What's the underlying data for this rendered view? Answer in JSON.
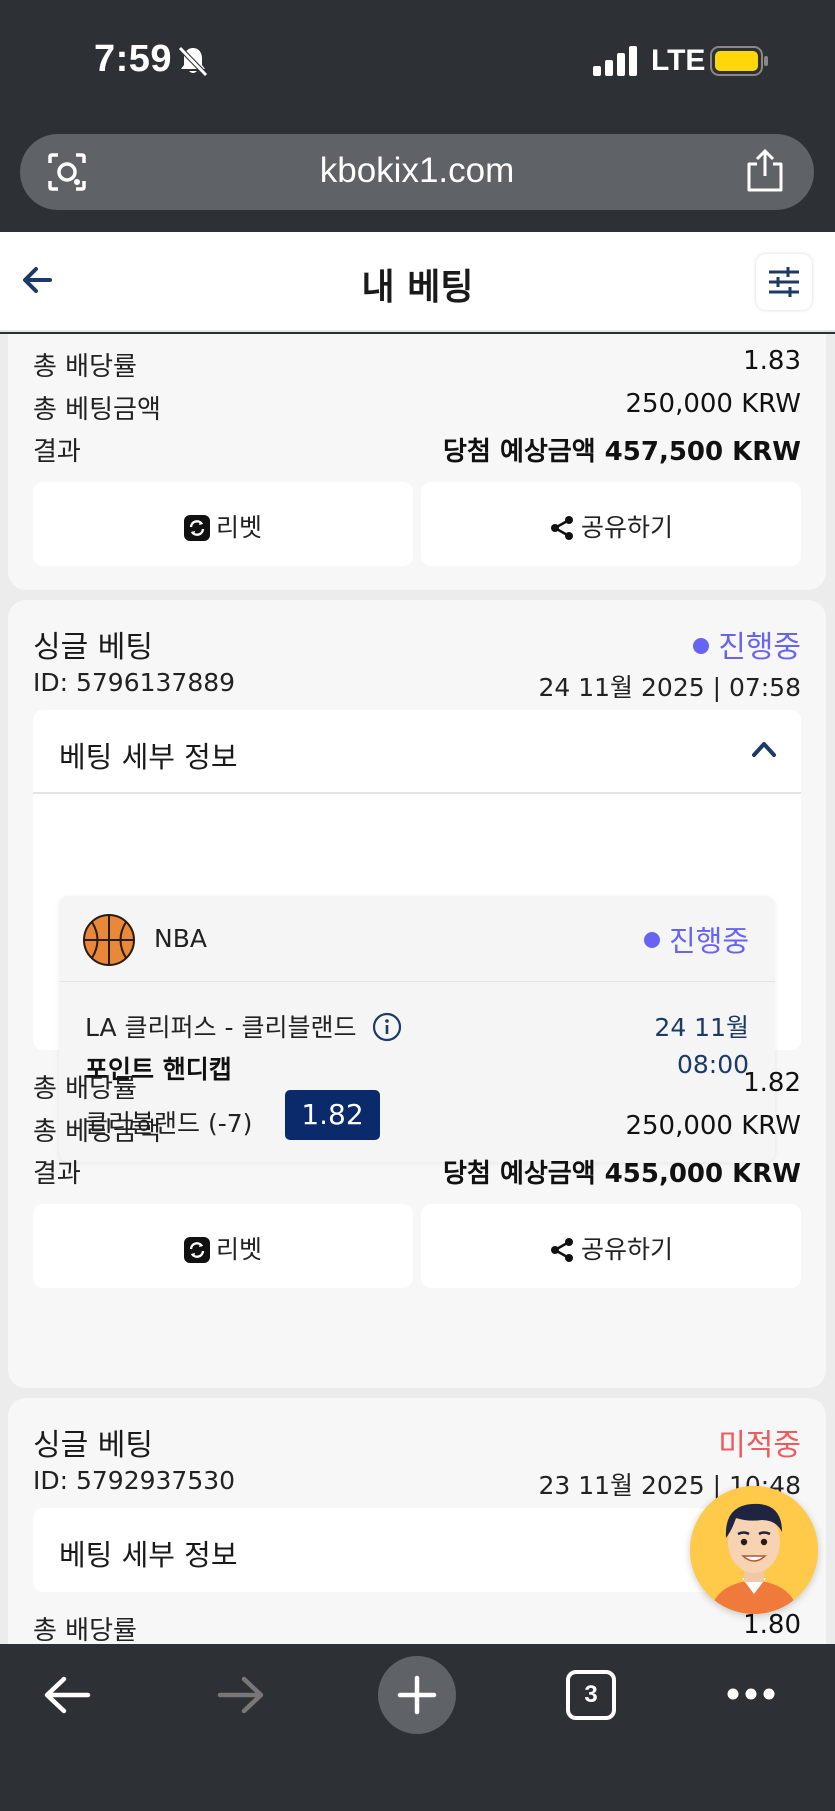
{
  "status_bar": {
    "time": "7:59",
    "network": "LTE",
    "icons": [
      "bell-off-icon",
      "signal-icon",
      "battery-icon"
    ]
  },
  "browser": {
    "url": "kbokix1.com",
    "tab_count": "3"
  },
  "header": {
    "title": "내 베팅"
  },
  "labels": {
    "total_odds": "총 배당률",
    "total_stake": "총 베팅금액",
    "result": "결과",
    "rebet": "리벳",
    "share": "공유하기",
    "detail": "베팅 세부 정보"
  },
  "bets": [
    {
      "total_odds": "1.83",
      "total_stake": "250,000 KRW",
      "result": "당첨 예상금액 457,500 KRW"
    },
    {
      "type": "싱글 베팅",
      "status": "진행중",
      "id": "ID: 5796137889",
      "date": "24 11월 2025 | 07:58",
      "selection": {
        "league": "NBA",
        "status": "진행중",
        "match": "LA 클리퍼스 - 클리블랜드",
        "match_date": "24 11월",
        "market": "포인트 핸디캡",
        "match_time": "08:00",
        "pick": "클리블랜드 (-7)",
        "odds": "1.82"
      },
      "total_odds": "1.82",
      "total_stake": "250,000 KRW",
      "result": "당첨 예상금액 455,000 KRW"
    },
    {
      "type": "싱글 베팅",
      "status": "미적중",
      "id": "ID: 5792937530",
      "date": "23 11월 2025 | 10:48",
      "total_odds": "1.80"
    }
  ],
  "colors": {
    "accent_purple": "#6763f5",
    "odds_navy": "#0b2a6b",
    "lost_red": "#f05a5a"
  }
}
